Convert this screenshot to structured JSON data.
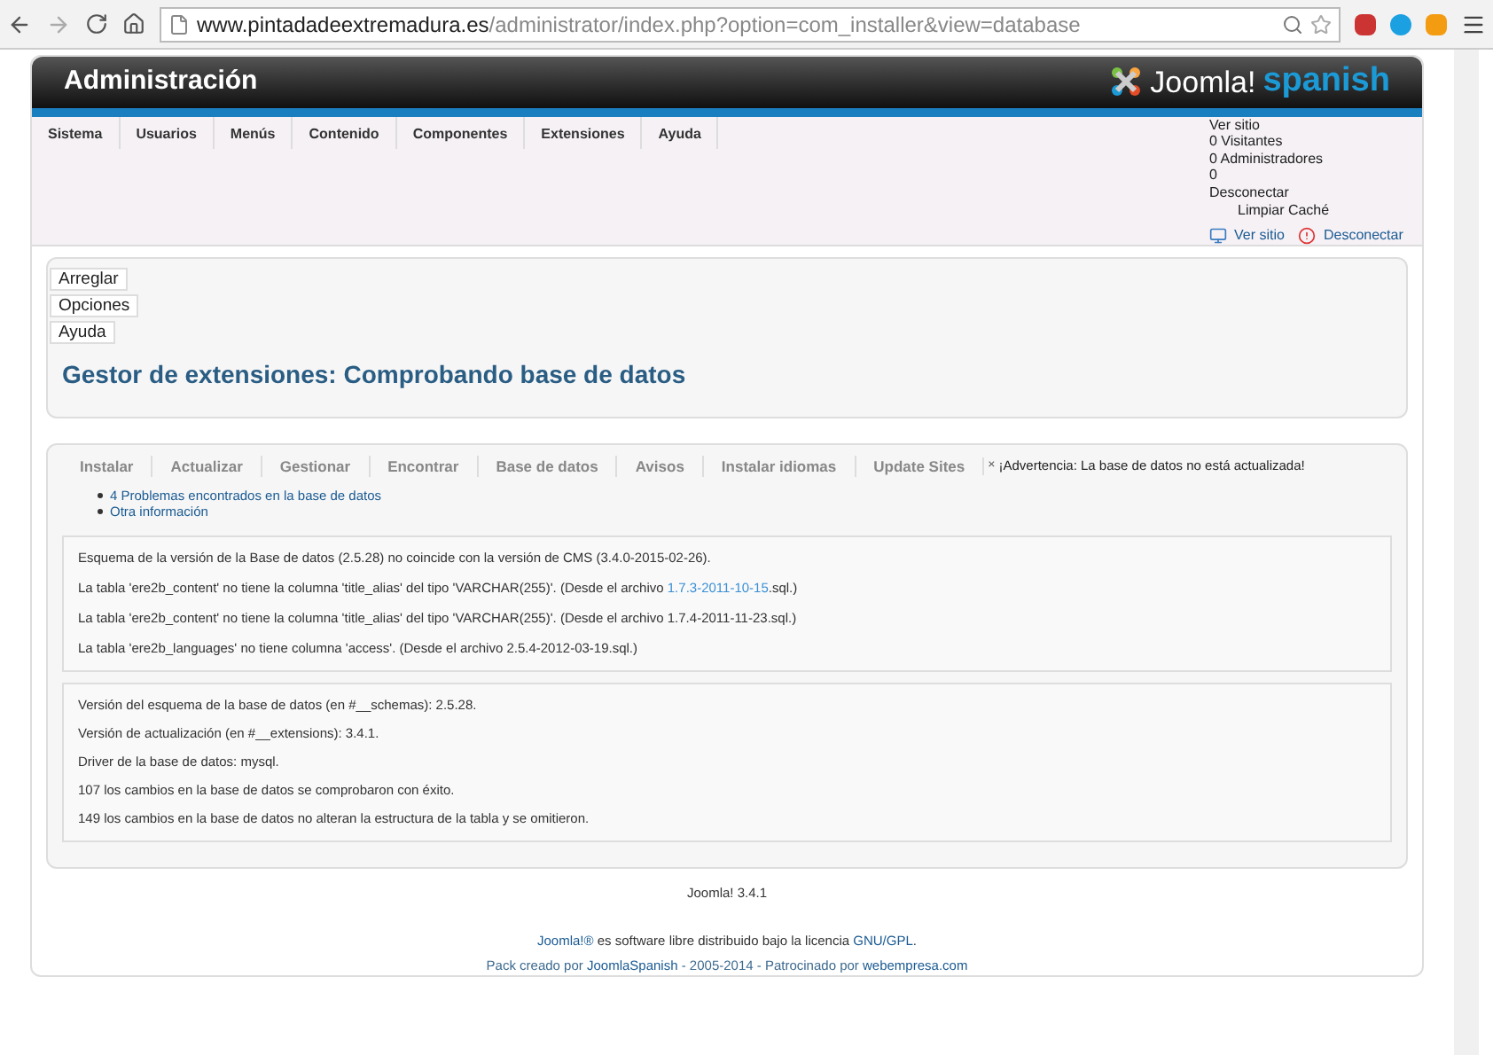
{
  "browser": {
    "url_host": "www.pintadadeextremadura.es",
    "url_path": "/administrator/index.php?option=com_installer&view=database"
  },
  "header": {
    "title": "Administración",
    "logo_text": "Joomla!",
    "logo_sub": "spanish"
  },
  "menu": [
    "Sistema",
    "Usuarios",
    "Menús",
    "Contenido",
    "Componentes",
    "Extensiones",
    "Ayuda"
  ],
  "status": {
    "lines": [
      "Ver sitio",
      "0 Visitantes",
      "0 Administradores",
      "0",
      "Desconectar",
      "Limpiar Caché"
    ],
    "links": [
      {
        "label": "Ver sitio",
        "kind": "site"
      },
      {
        "label": "Desconectar",
        "kind": "logout"
      }
    ]
  },
  "toolbar": [
    "Arreglar",
    "Opciones",
    "Ayuda"
  ],
  "page_title": "Gestor de extensiones: Comprobando base de datos",
  "tabs": [
    {
      "label": "Instalar",
      "selected": false
    },
    {
      "label": "Actualizar",
      "selected": false
    },
    {
      "label": "Gestionar",
      "selected": false
    },
    {
      "label": "Encontrar",
      "selected": false
    },
    {
      "label": "Base de datos",
      "selected": false
    },
    {
      "label": "Avisos",
      "selected": false
    },
    {
      "label": "Instalar idiomas",
      "selected": false
    },
    {
      "label": "Update Sites",
      "selected": false
    }
  ],
  "warning": {
    "close": "×",
    "text": "¡Advertencia: La base de datos no está actualizada!"
  },
  "summary_links": [
    "4 Problemas encontrados en la base de datos",
    "Otra información"
  ],
  "problems": [
    {
      "parts": [
        {
          "kind": "text",
          "text": "Esquema de la versión de la Base de datos (2.5.28) no coincide con la versión de CMS (3.4.0-2015-02-26)."
        }
      ]
    },
    {
      "parts": [
        {
          "kind": "text",
          "text": "La tabla 'ere2b_content' no tiene la columna 'title_alias' del tipo 'VARCHAR(255)'. (Desde el archivo "
        },
        {
          "kind": "link",
          "text": "1.7.3-2011-10-15"
        },
        {
          "kind": "text",
          "text": ".sql.)"
        }
      ]
    },
    {
      "parts": [
        {
          "kind": "text",
          "text": "La tabla 'ere2b_content' no tiene la columna 'title_alias' del tipo 'VARCHAR(255)'. (Desde el archivo 1.7.4-2011-11-23.sql.)"
        }
      ]
    },
    {
      "parts": [
        {
          "kind": "text",
          "text": "La tabla 'ere2b_languages' no tiene columna 'access'. (Desde el archivo 2.5.4-2012-03-19.sql.)"
        }
      ]
    }
  ],
  "info": [
    "Versión del esquema de la base de datos (en #__schemas): 2.5.28.",
    "Versión de actualización (en #__extensions): 3.4.1.",
    "Driver de la base de datos: mysql.",
    "107 los cambios en la base de datos se comprobaron con éxito.",
    "149 los cambios en la base de datos no alteran la estructura de la tabla y se omitieron."
  ],
  "footer": {
    "version": "Joomla! 3.4.1",
    "license": [
      {
        "kind": "link",
        "text": "Joomla!®"
      },
      {
        "kind": "text",
        "text": " es software libre distribuido bajo la licencia "
      },
      {
        "kind": "link",
        "text": "GNU/GPL"
      },
      {
        "kind": "text",
        "text": "."
      }
    ],
    "credits": [
      {
        "kind": "text",
        "text": "Pack creado por "
      },
      {
        "kind": "link",
        "text": "JoomlaSpanish"
      },
      {
        "kind": "text",
        "text": " - 2005-2014 - Patrocinado por "
      },
      {
        "kind": "link",
        "text": "webempresa.com"
      }
    ]
  }
}
